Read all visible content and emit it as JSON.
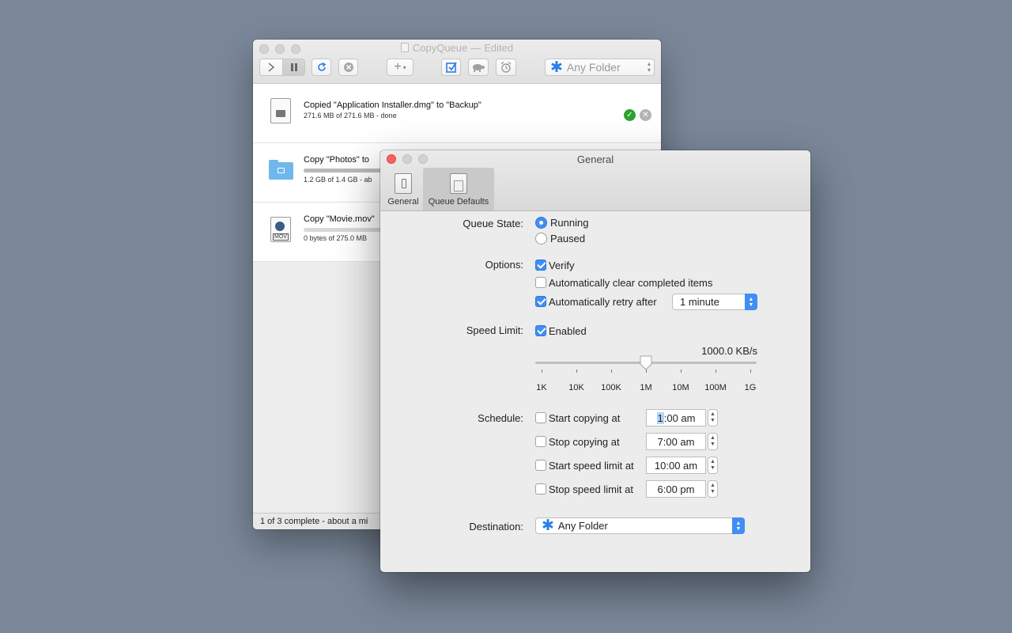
{
  "main_window": {
    "title": "CopyQueue",
    "title_suffix": "Edited",
    "toolbar": {
      "play_icon": "chevron-right-icon",
      "pause_icon": "pause-icon",
      "refresh_icon": "refresh-icon",
      "cancel_icon": "cancel-icon",
      "add_label": "+",
      "verify_icon": "verify-icon",
      "turtle_icon": "turtle-icon",
      "alarm_icon": "alarm-icon",
      "folder_select_value": "Any Folder"
    },
    "queue_items": [
      {
        "title": "Copied \"Application Installer.dmg\" to \"Backup\"",
        "subtitle": "271.6 MB of 271.6 MB - done",
        "progress": 1.0,
        "icon": "dmg-file-icon",
        "status": "done"
      },
      {
        "title": "Copy \"Photos\" to",
        "subtitle": "1.2 GB of 1.4 GB - ab",
        "progress": 0.86,
        "icon": "folder-icon",
        "status": "copying"
      },
      {
        "title": "Copy \"Movie.mov\"",
        "subtitle": "0 bytes of 275.0 MB",
        "progress": 0.0,
        "icon": "mov-file-icon",
        "status": "queued"
      }
    ],
    "status_text": "1 of 3 complete - about a mi"
  },
  "prefs_window": {
    "title": "General",
    "tabs": [
      {
        "label": "General",
        "selected": false
      },
      {
        "label": "Queue Defaults",
        "selected": true
      }
    ],
    "queue_state": {
      "label": "Queue State:",
      "options": [
        {
          "label": "Running",
          "selected": true
        },
        {
          "label": "Paused",
          "selected": false
        }
      ]
    },
    "options": {
      "label": "Options:",
      "verify": {
        "label": "Verify",
        "checked": true
      },
      "auto_clear": {
        "label": "Automatically clear completed items",
        "checked": false
      },
      "auto_retry": {
        "label": "Automatically retry after",
        "checked": true,
        "interval": "1 minute"
      }
    },
    "speed_limit": {
      "label": "Speed Limit:",
      "enabled": {
        "label": "Enabled",
        "checked": true
      },
      "value_text": "1000.0 KB/s",
      "ticks": [
        "1K",
        "10K",
        "100K",
        "1M",
        "10M",
        "100M",
        "1G"
      ],
      "slider_value": "1M"
    },
    "schedule": {
      "label": "Schedule:",
      "rows": [
        {
          "label": "Start copying at",
          "checked": false,
          "time_hour": "1",
          "time_rest": ":00 am"
        },
        {
          "label": "Stop copying at",
          "checked": false,
          "time": "7:00 am"
        },
        {
          "label": "Start speed limit at",
          "checked": false,
          "time": "10:00 am"
        },
        {
          "label": "Stop speed limit at",
          "checked": false,
          "time": "6:00 pm"
        }
      ]
    },
    "destination": {
      "label": "Destination:",
      "value": "Any Folder"
    }
  },
  "colors": {
    "desktop": "#7b889a",
    "accent": "#3f8ff4",
    "close_red": "#fc605c",
    "done_green": "#2ea12e"
  }
}
